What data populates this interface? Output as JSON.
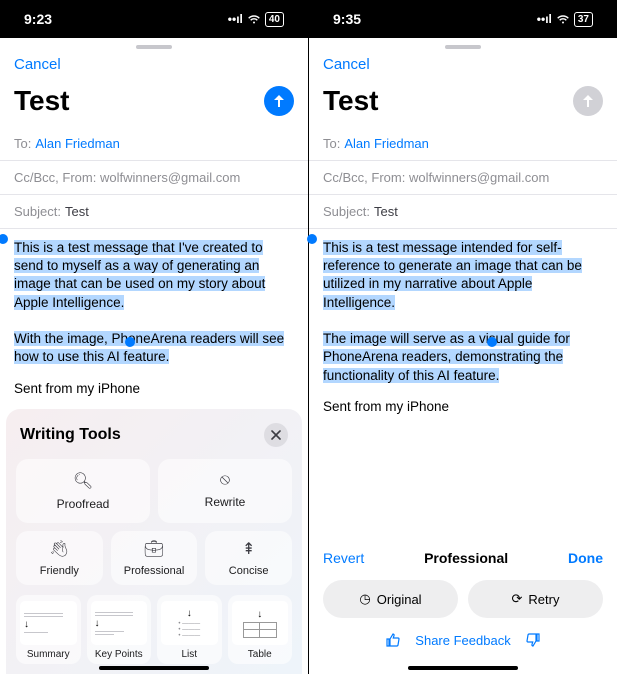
{
  "left": {
    "status": {
      "time": "9:23",
      "battery": "40"
    },
    "cancel": "Cancel",
    "title": "Test",
    "to_label": "To:",
    "to_value": "Alan Friedman",
    "cc_from": "Cc/Bcc, From: wolfwinners@gmail.com",
    "subject_label": "Subject:",
    "subject_value": "Test",
    "body_p1": "This is a test message that I've created to send to myself as a way of generating an image that can be used on my story about Apple Intelligence.",
    "body_p2": "With the image, PhoneArena readers will see how to use this AI feature.",
    "signature": "Sent from my iPhone",
    "wt": {
      "title": "Writing Tools",
      "proofread": "Proofread",
      "rewrite": "Rewrite",
      "friendly": "Friendly",
      "professional": "Professional",
      "concise": "Concise",
      "summary": "Summary",
      "keypoints": "Key Points",
      "list": "List",
      "table": "Table"
    }
  },
  "right": {
    "status": {
      "time": "9:35",
      "battery": "37"
    },
    "cancel": "Cancel",
    "title": "Test",
    "to_label": "To:",
    "to_value": "Alan Friedman",
    "cc_from": "Cc/Bcc, From: wolfwinners@gmail.com",
    "subject_label": "Subject:",
    "subject_value": "Test",
    "body_p1": "This is a test message intended for self-reference to generate an image that can be utilized in my narrative about Apple Intelligence.",
    "body_p2": "The image will serve as a visual guide for PhoneArena readers, demonstrating the functionality of this AI feature.",
    "signature": "Sent from my iPhone",
    "prof": {
      "revert": "Revert",
      "title": "Professional",
      "done": "Done",
      "original": "Original",
      "retry": "Retry",
      "share": "Share Feedback"
    }
  }
}
